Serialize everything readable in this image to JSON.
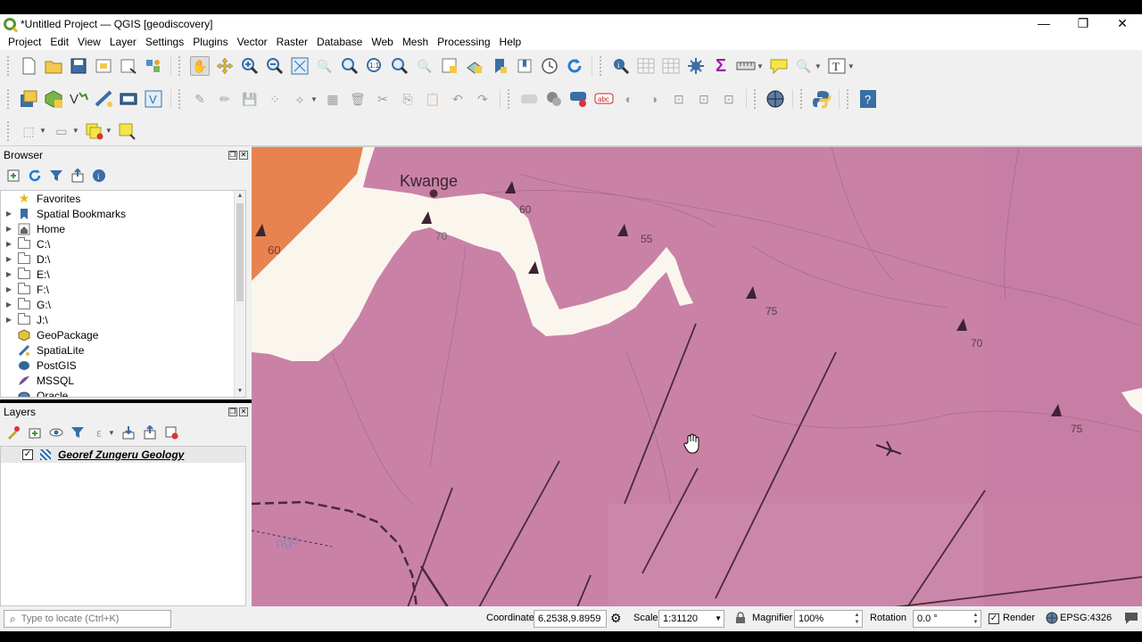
{
  "window": {
    "title": "*Untitled Project — QGIS [geodiscovery]",
    "controls": {
      "minimize": "—",
      "restore": "❐",
      "close": "✕"
    }
  },
  "menu": [
    "Project",
    "Edit",
    "View",
    "Layer",
    "Settings",
    "Plugins",
    "Vector",
    "Raster",
    "Database",
    "Web",
    "Mesh",
    "Processing",
    "Help"
  ],
  "browser": {
    "title": "Browser",
    "items": [
      {
        "label": "Favorites",
        "icon": "star-icon",
        "expandable": false
      },
      {
        "label": "Spatial Bookmarks",
        "icon": "bookmark-icon",
        "expandable": true
      },
      {
        "label": "Home",
        "icon": "home-icon",
        "expandable": true
      },
      {
        "label": "C:\\",
        "icon": "folder-icon",
        "expandable": true
      },
      {
        "label": "D:\\",
        "icon": "folder-icon",
        "expandable": true
      },
      {
        "label": "E:\\",
        "icon": "folder-icon",
        "expandable": true
      },
      {
        "label": "F:\\",
        "icon": "folder-icon",
        "expandable": true
      },
      {
        "label": "G:\\",
        "icon": "folder-icon",
        "expandable": true
      },
      {
        "label": "J:\\",
        "icon": "folder-icon",
        "expandable": true
      },
      {
        "label": "GeoPackage",
        "icon": "geopackage-icon",
        "expandable": false
      },
      {
        "label": "SpatiaLite",
        "icon": "spatialite-icon",
        "expandable": false
      },
      {
        "label": "PostGIS",
        "icon": "postgis-icon",
        "expandable": false
      },
      {
        "label": "MSSQL",
        "icon": "mssql-icon",
        "expandable": false
      },
      {
        "label": "Oracle",
        "icon": "oracle-icon",
        "expandable": false
      }
    ]
  },
  "layers": {
    "title": "Layers",
    "items": [
      {
        "name": "Georef Zungeru Geology",
        "checked": "✓"
      }
    ]
  },
  "map": {
    "place_label": "Kwange",
    "dip_labels": [
      "60",
      "70",
      "60",
      "55",
      "75",
      "70",
      "75"
    ],
    "partial_label": "ngo"
  },
  "status": {
    "locator_placeholder": "Type to locate (Ctrl+K)",
    "coordinate_label": "Coordinate",
    "coordinate_value": "6.2538,9.8959",
    "scale_label": "Scale",
    "scale_value": "1:31120",
    "magnifier_label": "Magnifier",
    "magnifier_value": "100%",
    "rotation_label": "Rotation",
    "rotation_value": "0.0 °",
    "render_label": "Render",
    "render_checked": "✓",
    "crs": "EPSG:4326"
  }
}
